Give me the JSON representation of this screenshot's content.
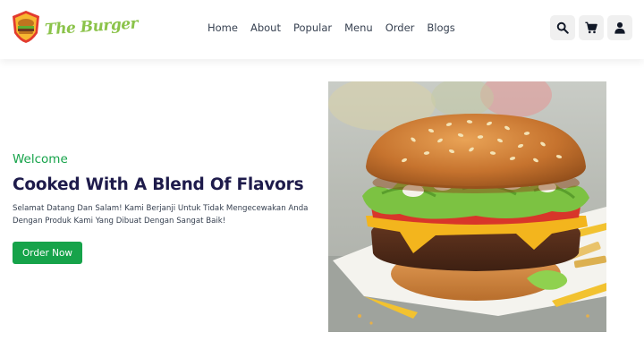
{
  "brand": {
    "name": "The Burger",
    "primary_color": "#16a34a",
    "accent_color": "#8bc34a"
  },
  "nav": {
    "links": [
      "Home",
      "About",
      "Popular",
      "Menu",
      "Order",
      "Blogs"
    ],
    "icons": [
      "search-icon",
      "cart-icon",
      "user-icon"
    ]
  },
  "hero": {
    "welcome": "Welcome",
    "title": "Cooked With A Blend Of Flavors",
    "description_line1": "Selamat Datang Dan Salam! Kami Berjanji Untuk Tidak Mengecewakan Anda",
    "description_line2": "Dengan Produk Kami Yang Dibuat Dengan Sangat Baik!",
    "cta_label": "Order Now"
  }
}
